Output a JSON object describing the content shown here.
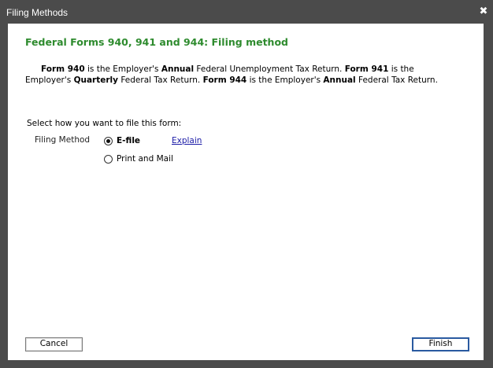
{
  "window": {
    "title": "Filing Methods",
    "close_glyph": "✖"
  },
  "main": {
    "heading": "Federal Forms 940, 941 and 944: Filing method",
    "description": {
      "p1_form": "Form 940",
      "p1_text1": " is the Employer's ",
      "p1_annual": "Annual",
      "p1_text2": " Federal Unemployment Tax Return. ",
      "p2_form": "Form 941",
      "p2_text1": " is the Employer's ",
      "p2_quarterly": "Quarterly",
      "p2_text2": " Federal Tax Return. ",
      "p3_form": "Form 944",
      "p3_text1": " is the Employer's ",
      "p3_annual": "Annual",
      "p3_text2": " Federal Tax Return."
    },
    "prompt": "Select how you want to file this form:",
    "method_label": "Filing Method",
    "options": [
      {
        "label": "E-file",
        "checked": true
      },
      {
        "label": "Print and Mail",
        "checked": false
      }
    ],
    "explain_link": "Explain"
  },
  "buttons": {
    "cancel": "Cancel",
    "finish": "Finish"
  },
  "colors": {
    "heading": "#2e8b2e",
    "titlebar": "#4b4b4b",
    "link": "#1a1aa6",
    "finish_border": "#2a5aa0"
  },
  "icons": {
    "close": "close-icon"
  }
}
